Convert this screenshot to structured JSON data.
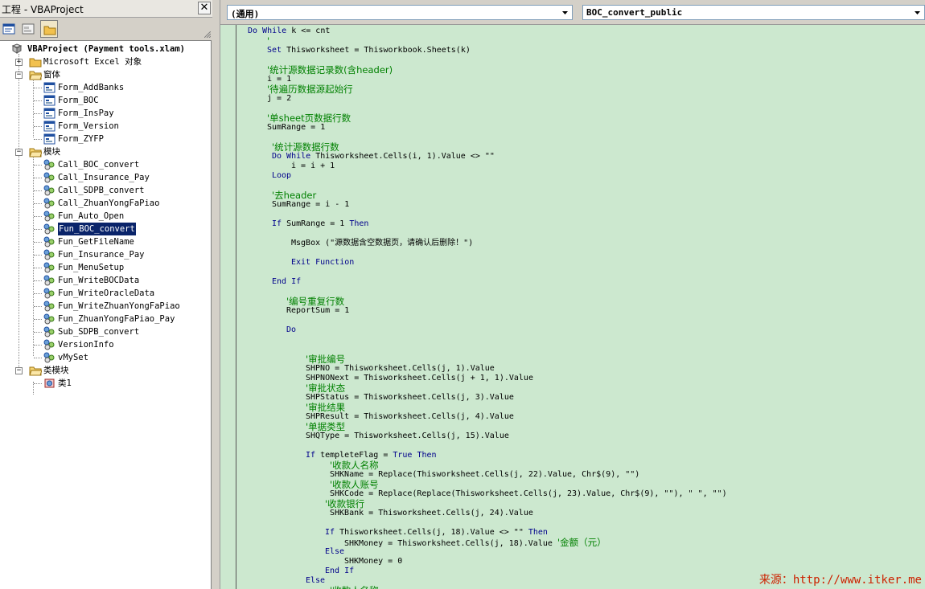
{
  "project_pane": {
    "title": "工程 - VBAProject",
    "close_glyph": "✕"
  },
  "tree": {
    "root": "VBAProject (Payment tools.xlam)",
    "excel_objects": "Microsoft Excel 对象",
    "forms_group": "窗体",
    "forms": [
      "Form_AddBanks",
      "Form_BOC",
      "Form_InsPay",
      "Form_Version",
      "Form_ZYFP"
    ],
    "modules_group": "模块",
    "modules": [
      "Call_BOC_convert",
      "Call_Insurance_Pay",
      "Call_SDPB_convert",
      "Call_ZhuanYongFaPiao",
      "Fun_Auto_Open",
      "Fun_BOC_convert",
      "Fun_GetFileName",
      "Fun_Insurance_Pay",
      "Fun_MenuSetup",
      "Fun_WriteBOCData",
      "Fun_WriteOracleData",
      "Fun_WriteZhuanYongFaPiao",
      "Fun_ZhuanYongFaPiao_Pay",
      "Sub_SDPB_convert",
      "VersionInfo",
      "vMySet"
    ],
    "selected_module": "Fun_BOC_convert",
    "class_group": "类模块",
    "classes": [
      "类1"
    ]
  },
  "code_window": {
    "object_combo": "(通用)",
    "procedure_combo": "BOC_convert_public"
  },
  "code_lines": [
    [
      [
        "kw",
        "Do While"
      ],
      [
        "tx",
        " k <= cnt"
      ]
    ],
    [
      [
        "cm",
        "'"
      ]
    ],
    [
      [
        "kw",
        "Set"
      ],
      [
        "tx",
        " Thisworksheet = Thisworkbook.Sheets(k)"
      ]
    ],
    [],
    [
      [
        "cm",
        "'统计源数据记录数(含header)"
      ]
    ],
    [
      [
        "tx",
        "i = 1"
      ]
    ],
    [
      [
        "cm",
        "'待遍历数据源起始行"
      ]
    ],
    [
      [
        "tx",
        "j = 2"
      ]
    ],
    [],
    [
      [
        "cm",
        "'单sheet页数据行数"
      ]
    ],
    [
      [
        "tx",
        "SumRange = 1"
      ]
    ],
    [],
    [
      [
        "cm",
        "'统计源数据行数"
      ]
    ],
    [
      [
        "kw",
        "Do While"
      ],
      [
        "tx",
        " Thisworksheet.Cells(i, 1).Value <> \"\""
      ]
    ],
    [
      [
        "tx",
        "i = i + 1"
      ]
    ],
    [
      [
        "kw",
        "Loop"
      ]
    ],
    [],
    [
      [
        "cm",
        "'去header"
      ]
    ],
    [
      [
        "tx",
        "SumRange = i - 1"
      ]
    ],
    [],
    [
      [
        "kw",
        "If"
      ],
      [
        "tx",
        " SumRange = 1 "
      ],
      [
        "kw",
        "Then"
      ]
    ],
    [],
    [
      [
        "tx",
        "MsgBox (\"源数据含空数据页，请确认后删除！\")"
      ]
    ],
    [],
    [
      [
        "kw",
        "Exit Function"
      ]
    ],
    [],
    [
      [
        "kw",
        "End If"
      ]
    ],
    [],
    [
      [
        "cm",
        "'编号重复行数"
      ]
    ],
    [
      [
        "tx",
        "ReportSum = 1"
      ]
    ],
    [],
    [
      [
        "kw",
        "Do"
      ]
    ],
    [],
    [],
    [
      [
        "cm",
        "'审批编号"
      ]
    ],
    [
      [
        "tx",
        "SHPNO = Thisworksheet.Cells(j, 1).Value"
      ]
    ],
    [
      [
        "tx",
        "SHPNONext = Thisworksheet.Cells(j + 1, 1).Value"
      ]
    ],
    [
      [
        "cm",
        "'审批状态"
      ]
    ],
    [
      [
        "tx",
        "SHPStatus = Thisworksheet.Cells(j, 3).Value"
      ]
    ],
    [
      [
        "cm",
        "'审批结果"
      ]
    ],
    [
      [
        "tx",
        "SHPResult = Thisworksheet.Cells(j, 4).Value"
      ]
    ],
    [
      [
        "cm",
        "'单据类型"
      ]
    ],
    [
      [
        "tx",
        "SHQType = Thisworksheet.Cells(j, 15).Value"
      ]
    ],
    [],
    [
      [
        "kw",
        "If"
      ],
      [
        "tx",
        " templeteFlag = "
      ],
      [
        "kw",
        "True Then"
      ]
    ],
    [
      [
        "cm",
        "'收款人名称"
      ]
    ],
    [
      [
        "tx",
        "SHKName = Replace(Thisworksheet.Cells(j, 22).Value, Chr$(9), \"\")"
      ]
    ],
    [
      [
        "cm",
        "'收款人账号"
      ]
    ],
    [
      [
        "tx",
        "SHKCode = Replace(Replace(Thisworksheet.Cells(j, 23).Value, Chr$(9), \"\"), \" \", \"\")"
      ]
    ],
    [
      [
        "cm",
        "'收款银行"
      ]
    ],
    [
      [
        "tx",
        "SHKBank = Thisworksheet.Cells(j, 24).Value"
      ]
    ],
    [],
    [
      [
        "kw",
        "If"
      ],
      [
        "tx",
        " Thisworksheet.Cells(j, 18).Value <> \"\" "
      ],
      [
        "kw",
        "Then"
      ]
    ],
    [
      [
        "tx",
        "SHKMoney = Thisworksheet.Cells(j, 18).Value "
      ],
      [
        "cm",
        "'金额（元）"
      ]
    ],
    [
      [
        "kw",
        "Else"
      ]
    ],
    [
      [
        "tx",
        "SHKMoney = 0"
      ]
    ],
    [
      [
        "kw",
        "End If"
      ]
    ],
    [
      [
        "kw",
        "Else"
      ]
    ],
    [
      [
        "cm",
        "'收款人名称"
      ]
    ]
  ],
  "watermark": "来源：http://www.itker.me"
}
